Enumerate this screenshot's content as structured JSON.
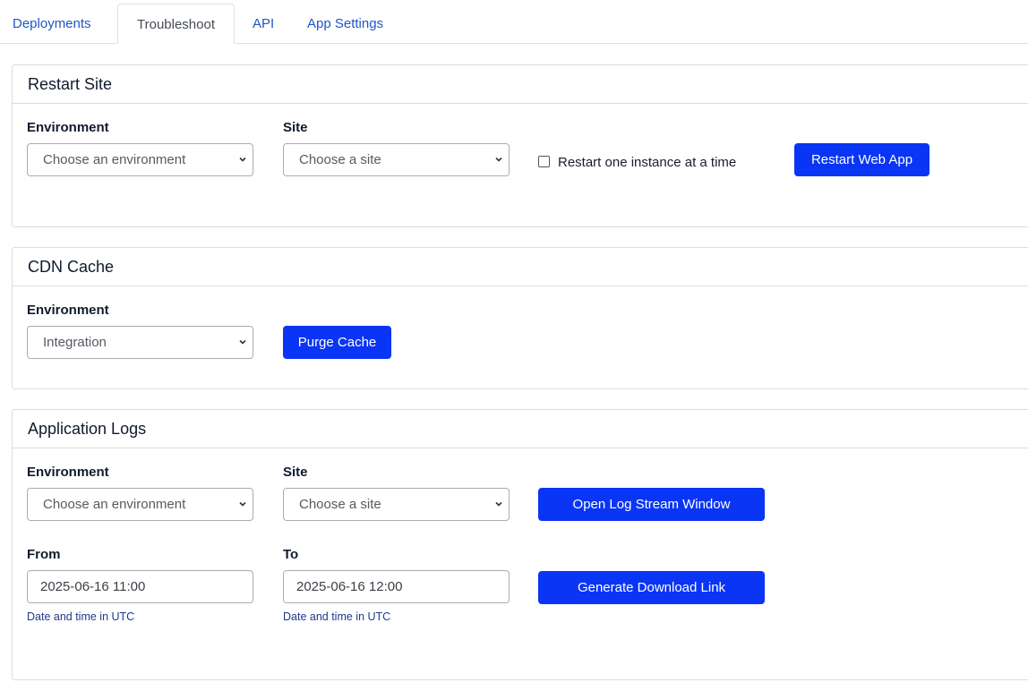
{
  "tabs": [
    {
      "label": "Deployments",
      "active": false
    },
    {
      "label": "Troubleshoot",
      "active": true
    },
    {
      "label": "API",
      "active": false
    },
    {
      "label": "App Settings",
      "active": false
    }
  ],
  "restart_site": {
    "title": "Restart Site",
    "environment_label": "Environment",
    "environment_value": "Choose an environment",
    "site_label": "Site",
    "site_value": "Choose a site",
    "checkbox_label": "Restart one instance at a time",
    "checkbox_checked": false,
    "button_label": "Restart Web App"
  },
  "cdn_cache": {
    "title": "CDN Cache",
    "environment_label": "Environment",
    "environment_value": "Integration",
    "button_label": "Purge Cache"
  },
  "app_logs": {
    "title": "Application Logs",
    "environment_label": "Environment",
    "environment_value": "Choose an environment",
    "site_label": "Site",
    "site_value": "Choose a site",
    "open_stream_label": "Open Log Stream Window",
    "from_label": "From",
    "from_value": "2025-06-16 11:00",
    "from_hint": "Date and time in UTC",
    "to_label": "To",
    "to_value": "2025-06-16 12:00",
    "to_hint": "Date and time in UTC",
    "download_label": "Generate Download Link"
  },
  "colors": {
    "primary_button": "#0a35f5",
    "tab_link": "#1f56c7",
    "hint_text": "#1f3a8f"
  },
  "icons": {
    "select_arrow": "chevron-down-icon"
  }
}
